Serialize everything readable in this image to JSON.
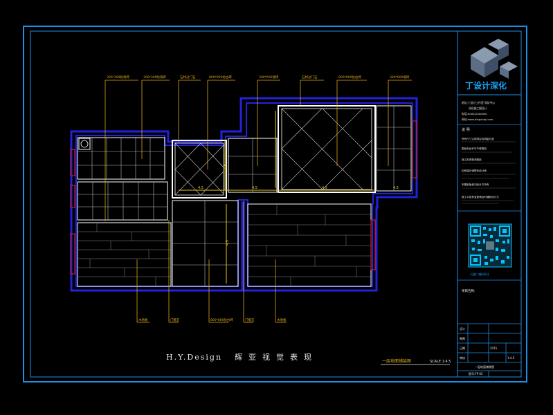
{
  "drawing": {
    "credit_en": "H.Y.Design",
    "credit_cn": "辉亚视觉表现",
    "plan_title": "一层地面铺装图",
    "scale_text": "SCALE 1:4.5"
  },
  "callouts": {
    "top": [
      "300*300防滑砖",
      "300*300防滑砖",
      "石材过门石",
      "800*800仿古砖",
      "300*600墙砖",
      "石材过门石",
      "800*800仿古砖",
      "300*600墙砖"
    ],
    "bottom": [
      "木地板",
      "门槛石",
      "800*800仿古砖",
      "门槛石",
      "木地板"
    ]
  },
  "dimension_labels": [
    "4.5",
    "4.5",
    "4.5",
    "4.5",
    "4.5",
    "4.5"
  ],
  "title_block": {
    "logo_text": "丁设计深化",
    "address_lines": [
      "地址:丁设计工作室·深化中心",
      "深化施工图设计",
      "电话:0000-0000000",
      "网站:www.dingsheji.com"
    ],
    "notes_header": "说 明",
    "notes": [
      "所有尺寸以现场实际测量为准",
      "图纸未经许可不得复制",
      "施工前请核对图纸",
      "如有疑问请联系设计师",
      "本图纸版权归设计方所有",
      "施工中如有变更请及时通知设计方"
    ],
    "qr_caption": "扫描二维码关注",
    "project_label": "项目名称:",
    "rows": [
      {
        "left": "设计",
        "right": ""
      },
      {
        "left": "制图",
        "right": ""
      },
      {
        "left": "日期",
        "right": "2015"
      },
      {
        "left": "审核",
        "right": "1:4.5"
      },
      {
        "left": "",
        "right": "一层地面铺装图"
      }
    ],
    "sheet_label": "图号:FP-05"
  },
  "colors": {
    "frame": "#1e8fe6",
    "wall": "#2222dd",
    "tile": "#ffffff",
    "callout": "#e0a81a",
    "window": "#d21e1e",
    "text": "#e8e8e8",
    "dimension": "#e8c81e",
    "qr": "#00c8ff"
  }
}
